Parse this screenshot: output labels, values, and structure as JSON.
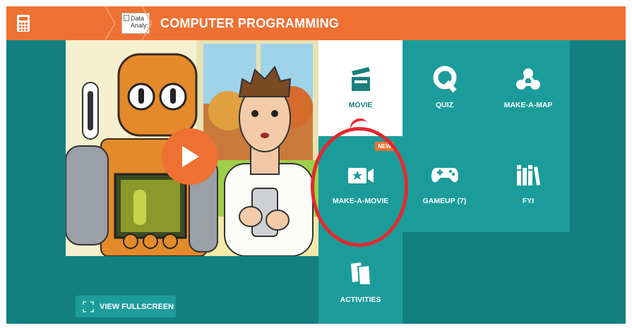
{
  "header": {
    "title": "COMPUTER PROGRAMMING",
    "thumbnail_alt": "Data Analy:"
  },
  "video": {
    "fullscreen_label": "VIEW FULLSCREEN"
  },
  "tiles": [
    {
      "label": "MOVIE",
      "icon": "clapperboard-icon"
    },
    {
      "label": "QUIZ",
      "icon": "q-icon"
    },
    {
      "label": "MAKE-A-MAP",
      "icon": "map-nodes-icon"
    },
    {
      "label": "MAKE-A-MOVIE",
      "icon": "camera-star-icon",
      "badge": "NEW"
    },
    {
      "label": "GAMEUP (7)",
      "icon": "gamepad-icon"
    },
    {
      "label": "FYI",
      "icon": "books-icon"
    },
    {
      "label": "ACTIVITIES",
      "icon": "pages-icon"
    }
  ],
  "colors": {
    "header_orange": "#ee7133",
    "stage_teal": "#137f80",
    "tile_teal": "#1b9c9b",
    "highlight_red": "#e2292f"
  }
}
